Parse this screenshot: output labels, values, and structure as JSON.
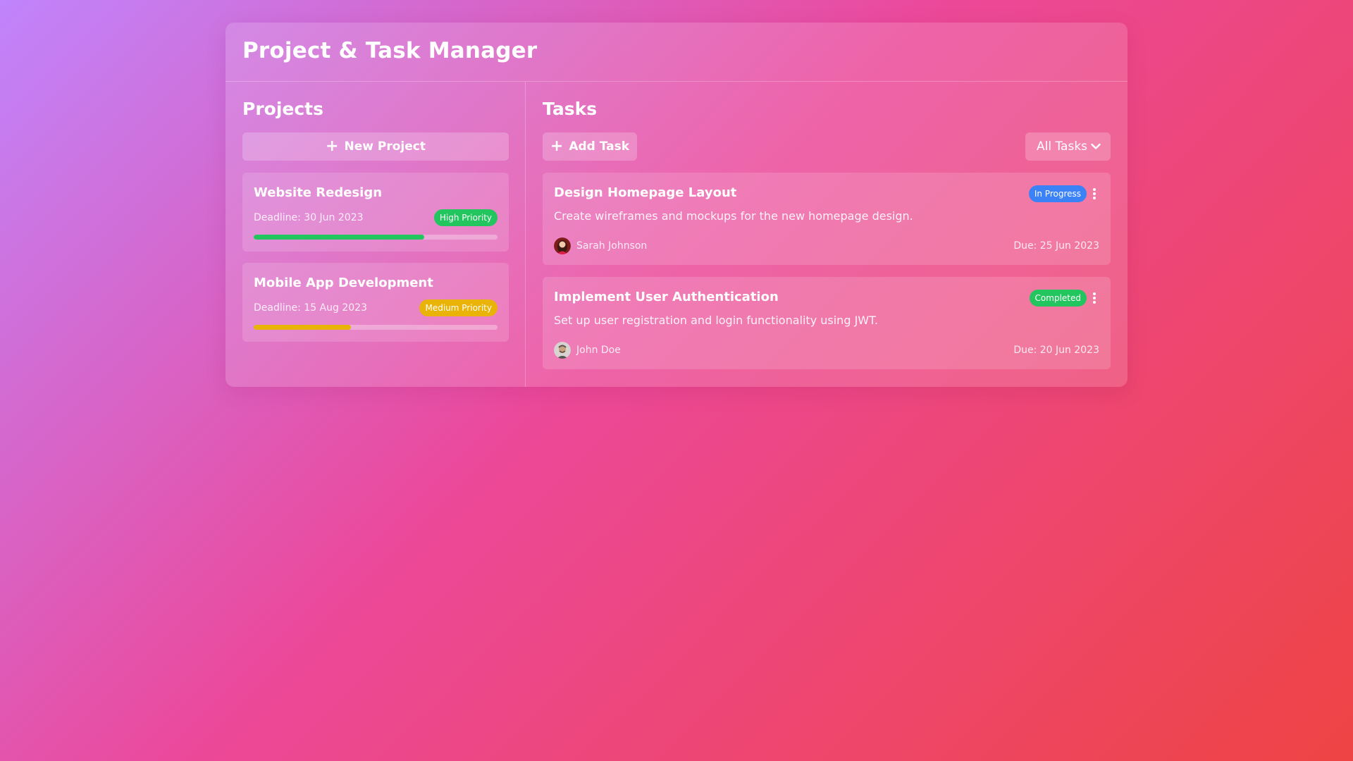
{
  "app": {
    "title": "Project & Task Manager"
  },
  "projects": {
    "heading": "Projects",
    "new_button": {
      "icon": "plus-icon",
      "label": "New Project"
    },
    "items": [
      {
        "name": "Website Redesign",
        "deadline": "Deadline: 30 Jun 2023",
        "priority": "High Priority",
        "priority_color": "#22c55e",
        "progress": 0.7
      },
      {
        "name": "Mobile App Development",
        "deadline": "Deadline: 15 Aug 2023",
        "priority": "Medium Priority",
        "priority_color": "#eab308",
        "progress": 0.4
      }
    ]
  },
  "tasks": {
    "heading": "Tasks",
    "add_button": {
      "icon": "plus-icon",
      "label": "Add Task"
    },
    "filter": {
      "selected": "All Tasks",
      "icon": "chevron-down-icon"
    },
    "items": [
      {
        "title": "Design Homepage Layout",
        "status": "In Progress",
        "status_color": "#3b82f6",
        "description": "Create wireframes and mockups for the new homepage design.",
        "assignee": "Sarah Johnson",
        "due": "Due: 25 Jun 2023"
      },
      {
        "title": "Implement User Authentication",
        "status": "Completed",
        "status_color": "#22c55e",
        "description": "Set up user registration and login functionality using JWT.",
        "assignee": "John Doe",
        "due": "Due: 20 Jun 2023"
      }
    ]
  }
}
